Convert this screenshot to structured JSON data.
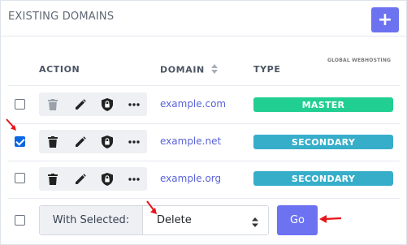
{
  "panel": {
    "title": "EXISTING DOMAINS",
    "add_button_label": "+",
    "watermark": "GLOBAL WEBHOSTING"
  },
  "table": {
    "headers": {
      "action": "ACTION",
      "domain": "DOMAIN",
      "type": "TYPE"
    },
    "rows": [
      {
        "domain": "example.com",
        "type": "MASTER",
        "checked": false,
        "type_color": "#21cf92"
      },
      {
        "domain": "example.net",
        "type": "SECONDARY",
        "checked": true,
        "type_color": "#37aec9"
      },
      {
        "domain": "example.org",
        "type": "SECONDARY",
        "checked": false,
        "type_color": "#37aec9"
      }
    ],
    "row_actions": [
      "trash-icon",
      "pencil-icon",
      "shield-lock-icon",
      "more-icon"
    ]
  },
  "bulk": {
    "with_selected_label": "With Selected:",
    "selected_option": "Delete",
    "go_label": "Go"
  },
  "colors": {
    "accent": "#6c72f0",
    "link": "#5a63d8",
    "master": "#21cf92",
    "secondary": "#37aec9",
    "annotation_arrow": "#e8141b"
  }
}
